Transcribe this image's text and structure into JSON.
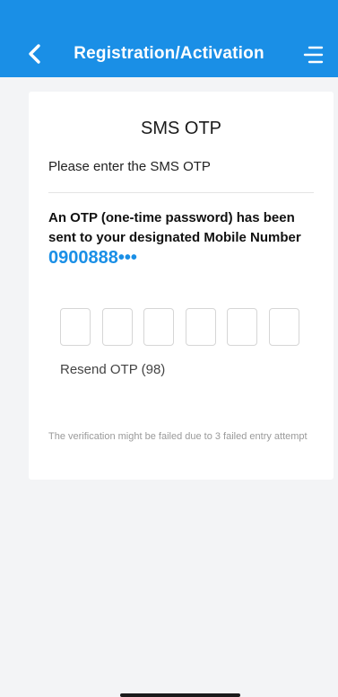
{
  "header": {
    "title": "Registration/Activation",
    "back_icon": "chevron-left-icon",
    "menu_icon": "menu-icon",
    "background_color": "#1a8fe6"
  },
  "card": {
    "title": "SMS OTP",
    "subtitle": "Please enter the SMS OTP",
    "message": "An OTP (one-time password) has been sent to your designated Mobile Number",
    "mobile_number": "0900888•••",
    "otp_boxes": [
      "",
      "",
      "",
      "",
      "",
      ""
    ],
    "resend_label": "Resend OTP (98)",
    "notice": "The verification might be failed due to 3 failed entry attempt"
  },
  "colors": {
    "accent": "#1a8fe6",
    "page_background": "#f3f4f6"
  }
}
